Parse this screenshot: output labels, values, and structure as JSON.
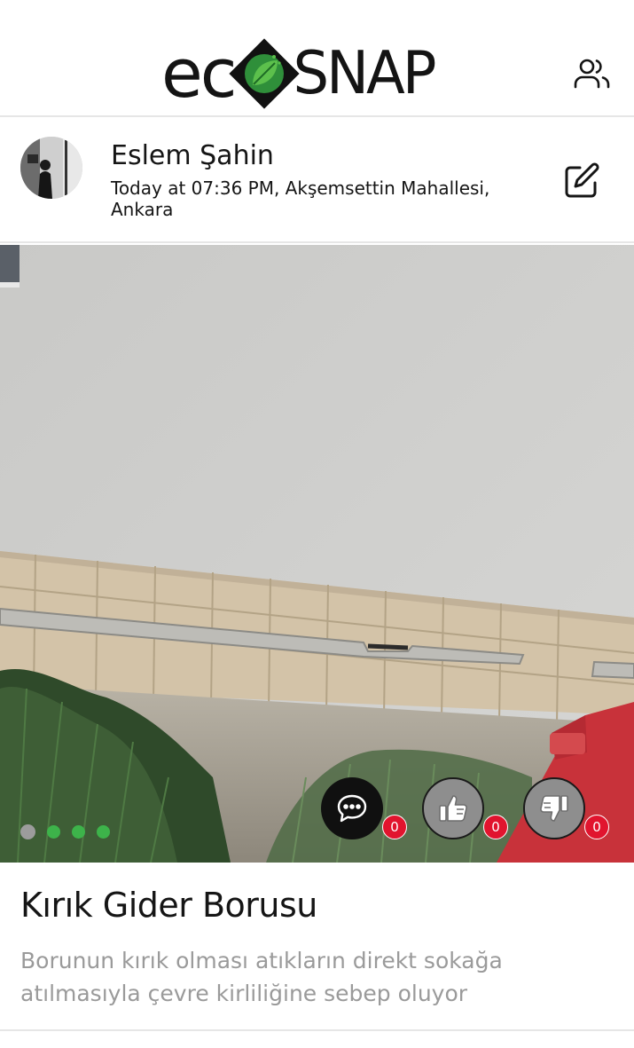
{
  "header": {
    "logo_left": "ec",
    "logo_right": "SNAP",
    "users_icon": "users-icon"
  },
  "post": {
    "author_name": "Eslem Şahin",
    "meta": "Today at 07:36 PM, Akşemsettin Mahallesi, Ankara",
    "edit_icon": "edit-icon",
    "photo": {
      "slide_count": 4,
      "active_slide": 1
    },
    "actions": {
      "comment": {
        "icon": "comment-icon",
        "count": "0"
      },
      "like": {
        "icon": "thumbs-up-icon",
        "count": "0"
      },
      "dislike": {
        "icon": "thumbs-down-icon",
        "count": "0"
      }
    },
    "title": "Kırık Gider Borusu",
    "description": "Borunun kırık olması atıkların direkt sokağa atılmasıyla çevre kirliliğine sebep oluyor"
  },
  "colors": {
    "accent_green": "#3db34a",
    "badge_red": "#e1142e",
    "muted_text": "#9a9a9a"
  }
}
